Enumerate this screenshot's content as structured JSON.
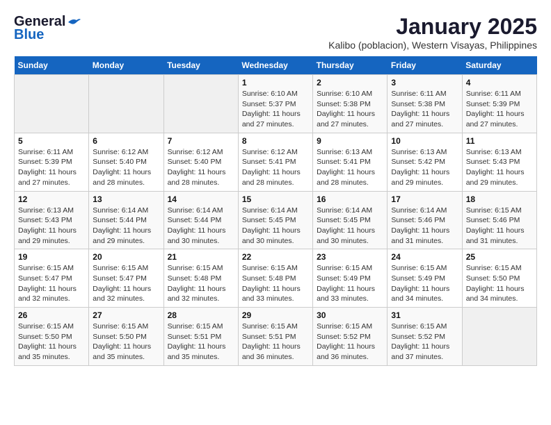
{
  "logo": {
    "line1": "General",
    "line2": "Blue"
  },
  "title": "January 2025",
  "subtitle": "Kalibo (poblacion), Western Visayas, Philippines",
  "days_of_week": [
    "Sunday",
    "Monday",
    "Tuesday",
    "Wednesday",
    "Thursday",
    "Friday",
    "Saturday"
  ],
  "weeks": [
    [
      {
        "day": "",
        "info": ""
      },
      {
        "day": "",
        "info": ""
      },
      {
        "day": "",
        "info": ""
      },
      {
        "day": "1",
        "sunrise": "6:10 AM",
        "sunset": "5:37 PM",
        "daylight": "11 hours and 27 minutes."
      },
      {
        "day": "2",
        "sunrise": "6:10 AM",
        "sunset": "5:38 PM",
        "daylight": "11 hours and 27 minutes."
      },
      {
        "day": "3",
        "sunrise": "6:11 AM",
        "sunset": "5:38 PM",
        "daylight": "11 hours and 27 minutes."
      },
      {
        "day": "4",
        "sunrise": "6:11 AM",
        "sunset": "5:39 PM",
        "daylight": "11 hours and 27 minutes."
      }
    ],
    [
      {
        "day": "5",
        "sunrise": "6:11 AM",
        "sunset": "5:39 PM",
        "daylight": "11 hours and 27 minutes."
      },
      {
        "day": "6",
        "sunrise": "6:12 AM",
        "sunset": "5:40 PM",
        "daylight": "11 hours and 28 minutes."
      },
      {
        "day": "7",
        "sunrise": "6:12 AM",
        "sunset": "5:40 PM",
        "daylight": "11 hours and 28 minutes."
      },
      {
        "day": "8",
        "sunrise": "6:12 AM",
        "sunset": "5:41 PM",
        "daylight": "11 hours and 28 minutes."
      },
      {
        "day": "9",
        "sunrise": "6:13 AM",
        "sunset": "5:41 PM",
        "daylight": "11 hours and 28 minutes."
      },
      {
        "day": "10",
        "sunrise": "6:13 AM",
        "sunset": "5:42 PM",
        "daylight": "11 hours and 29 minutes."
      },
      {
        "day": "11",
        "sunrise": "6:13 AM",
        "sunset": "5:43 PM",
        "daylight": "11 hours and 29 minutes."
      }
    ],
    [
      {
        "day": "12",
        "sunrise": "6:13 AM",
        "sunset": "5:43 PM",
        "daylight": "11 hours and 29 minutes."
      },
      {
        "day": "13",
        "sunrise": "6:14 AM",
        "sunset": "5:44 PM",
        "daylight": "11 hours and 29 minutes."
      },
      {
        "day": "14",
        "sunrise": "6:14 AM",
        "sunset": "5:44 PM",
        "daylight": "11 hours and 30 minutes."
      },
      {
        "day": "15",
        "sunrise": "6:14 AM",
        "sunset": "5:45 PM",
        "daylight": "11 hours and 30 minutes."
      },
      {
        "day": "16",
        "sunrise": "6:14 AM",
        "sunset": "5:45 PM",
        "daylight": "11 hours and 30 minutes."
      },
      {
        "day": "17",
        "sunrise": "6:14 AM",
        "sunset": "5:46 PM",
        "daylight": "11 hours and 31 minutes."
      },
      {
        "day": "18",
        "sunrise": "6:15 AM",
        "sunset": "5:46 PM",
        "daylight": "11 hours and 31 minutes."
      }
    ],
    [
      {
        "day": "19",
        "sunrise": "6:15 AM",
        "sunset": "5:47 PM",
        "daylight": "11 hours and 32 minutes."
      },
      {
        "day": "20",
        "sunrise": "6:15 AM",
        "sunset": "5:47 PM",
        "daylight": "11 hours and 32 minutes."
      },
      {
        "day": "21",
        "sunrise": "6:15 AM",
        "sunset": "5:48 PM",
        "daylight": "11 hours and 32 minutes."
      },
      {
        "day": "22",
        "sunrise": "6:15 AM",
        "sunset": "5:48 PM",
        "daylight": "11 hours and 33 minutes."
      },
      {
        "day": "23",
        "sunrise": "6:15 AM",
        "sunset": "5:49 PM",
        "daylight": "11 hours and 33 minutes."
      },
      {
        "day": "24",
        "sunrise": "6:15 AM",
        "sunset": "5:49 PM",
        "daylight": "11 hours and 34 minutes."
      },
      {
        "day": "25",
        "sunrise": "6:15 AM",
        "sunset": "5:50 PM",
        "daylight": "11 hours and 34 minutes."
      }
    ],
    [
      {
        "day": "26",
        "sunrise": "6:15 AM",
        "sunset": "5:50 PM",
        "daylight": "11 hours and 35 minutes."
      },
      {
        "day": "27",
        "sunrise": "6:15 AM",
        "sunset": "5:50 PM",
        "daylight": "11 hours and 35 minutes."
      },
      {
        "day": "28",
        "sunrise": "6:15 AM",
        "sunset": "5:51 PM",
        "daylight": "11 hours and 35 minutes."
      },
      {
        "day": "29",
        "sunrise": "6:15 AM",
        "sunset": "5:51 PM",
        "daylight": "11 hours and 36 minutes."
      },
      {
        "day": "30",
        "sunrise": "6:15 AM",
        "sunset": "5:52 PM",
        "daylight": "11 hours and 36 minutes."
      },
      {
        "day": "31",
        "sunrise": "6:15 AM",
        "sunset": "5:52 PM",
        "daylight": "11 hours and 37 minutes."
      },
      {
        "day": "",
        "info": ""
      }
    ]
  ]
}
